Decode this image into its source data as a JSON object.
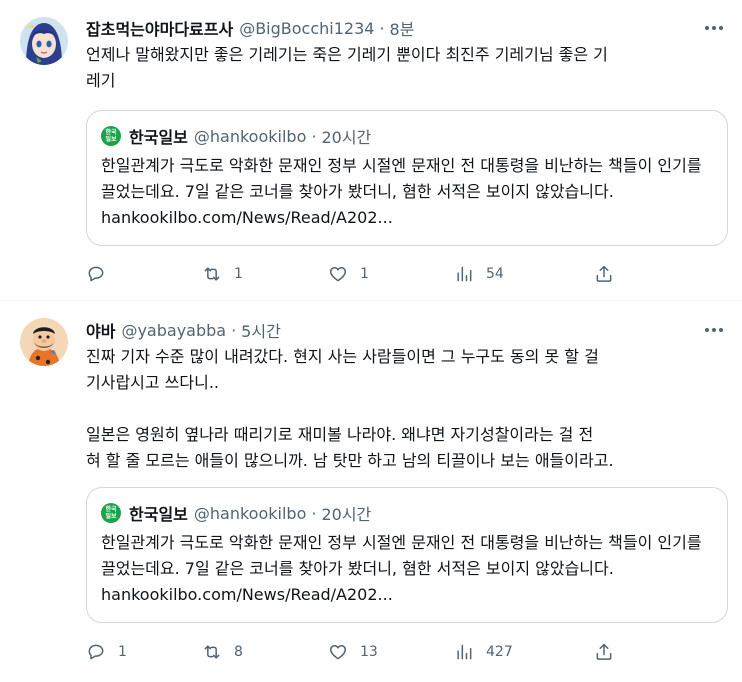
{
  "tweets": [
    {
      "author_name": "잡초먹는야마다료프사",
      "handle": "@BigBocchi1234",
      "separator": "·",
      "time": "8분",
      "text": "언제나 말해왔지만 좋은 기레기는 죽은 기레기 뿐이다 최진주 기레기님 좋은 기\n레기",
      "avatar_icon": "anime-girl-avatar",
      "quote": {
        "logo_text": "한국일보",
        "author_name": "한국일보",
        "handle": "@hankookilbo",
        "separator": "·",
        "time": "20시간",
        "text": "한일관계가 극도로 악화한 문재인 정부 시절엔 문재인 전 대통령을 비난하는 책들이 인기를 끌었는데요. 7일 같은 코너를 찾아가 봤더니, 혐한 서적은 보이지 않았습니다.  hankookilbo.com/News/Read/A202..."
      },
      "actions": {
        "reply": "",
        "retweet": "1",
        "like": "1",
        "views": "54"
      }
    },
    {
      "author_name": "야바",
      "handle": "@yabayabba",
      "separator": "·",
      "time": "5시간",
      "text": "진짜 기자 수준 많이 내려갔다. 현지 사는 사람들이면 그 누구도 동의 못 할 걸\n기사랍시고 쓰다니..\n\n일본은 영원히 옆나라 때리기로 재미볼 나라야. 왜냐면 자기성찰이라는 걸 전\n혀 할 줄 모르는 애들이 많으니까. 남 탓만 하고 남의 티끌이나 보는 애들이라고.",
      "avatar_icon": "caveman-avatar",
      "quote": {
        "logo_text": "한국일보",
        "author_name": "한국일보",
        "handle": "@hankookilbo",
        "separator": "·",
        "time": "20시간",
        "text": "한일관계가 극도로 악화한 문재인 정부 시절엔 문재인 전 대통령을 비난하는 책들이 인기를 끌었는데요. 7일 같은 코너를 찾아가 봤더니, 혐한 서적은 보이지 않았습니다.  hankookilbo.com/News/Read/A202..."
      },
      "actions": {
        "reply": "1",
        "retweet": "8",
        "like": "13",
        "views": "427"
      }
    }
  ],
  "colors": {
    "text_primary": "#0f1419",
    "text_secondary": "#536471",
    "border": "#cfd9de",
    "logo_green": "#1aa34a"
  }
}
